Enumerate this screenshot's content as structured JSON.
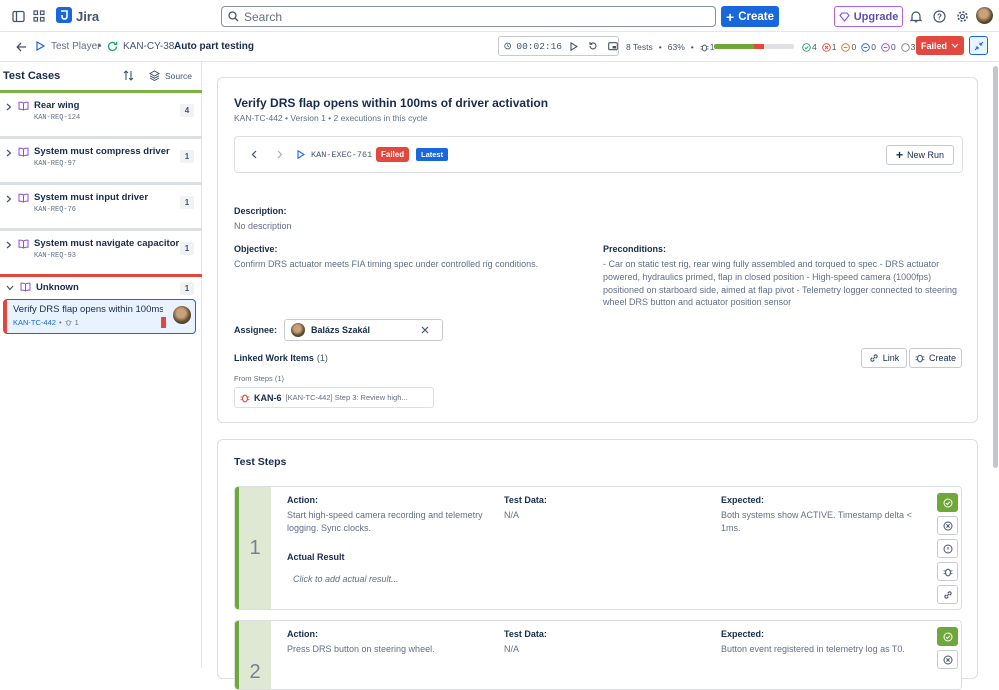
{
  "topbar": {
    "app_name": "Jira",
    "search_placeholder": "Search",
    "create_label": "Create",
    "upgrade_label": "Upgrade"
  },
  "player": {
    "crumb_root": "Test Player",
    "cycle_key": "KAN-CY-38",
    "cycle_name": "Auto part testing",
    "timer": "00:02:16",
    "tests_count": "8 Tests",
    "percent": "63%",
    "bug_count": "1",
    "progress": {
      "passed": 0.5,
      "failed": 0.125,
      "other": 0
    },
    "counts": {
      "passed": "4",
      "failed": "1",
      "blocked": "0",
      "in_progress": "0",
      "not_executed": "0",
      "other": "3"
    },
    "status": "Failed"
  },
  "left_panel": {
    "title": "Test Cases",
    "source_label": "Source",
    "groups": [
      {
        "name": "Rear wing",
        "key": "KAN-REQ-124",
        "count": "4",
        "color": "#7cb342"
      },
      {
        "name": "System must compress driver",
        "key": "KAN-REQ-97",
        "count": "1",
        "color": "#dcdfe4"
      },
      {
        "name": "System must input driver",
        "key": "KAN-REQ-76",
        "count": "1",
        "color": "#dcdfe4"
      },
      {
        "name": "System must navigate capacitor",
        "key": "KAN-REQ-93",
        "count": "1",
        "color": "#dcdfe4"
      },
      {
        "name": "Unknown",
        "key": "",
        "count": "1",
        "color": "#e2483d"
      }
    ],
    "selected_case": {
      "title": "Verify DRS flap opens within 100ms ...",
      "key": "KAN-TC-442",
      "bugs": "1"
    }
  },
  "test_case": {
    "title": "Verify DRS flap opens within 100ms of driver activation",
    "meta": "KAN-TC-442 • Version 1 • 2 executions in this cycle",
    "execution": {
      "key": "KAN-EXEC-761",
      "status": "Failed",
      "tag": "Latest",
      "new_run_label": "New Run"
    },
    "description_label": "Description:",
    "description": "No description",
    "objective_label": "Objective:",
    "objective": "Confirm DRS actuator meets FIA timing spec under controlled rig conditions.",
    "preconditions_label": "Preconditions:",
    "preconditions": "- Car on static test rig, rear wing fully assembled and torqued to spec - DRS actuator powered, hydraulics primed, flap in closed position - High-speed camera (1000fps) positioned on starboard side, aimed at flap pivot - Telemetry logger connected to steering wheel DRS button and actuator position sensor",
    "assignee_label": "Assignee:",
    "assignee": "Balázs Szakál",
    "linked_label": "Linked Work Items",
    "linked_count": "(1)",
    "link_btn": "Link",
    "create_btn": "Create",
    "from_steps": "From Steps (1)",
    "linked_item": {
      "key": "KAN-6",
      "summary": "[KAN-TC-442] Step 3: Review high..."
    }
  },
  "test_steps": {
    "title": "Test Steps",
    "action_label": "Action:",
    "data_label": "Test Data:",
    "expected_label": "Expected:",
    "actual_label": "Actual Result",
    "actual_placeholder": "Click to add actual result...",
    "steps": [
      {
        "num": "1",
        "action": "Start high-speed camera recording and telemetry logging. Sync clocks.",
        "data": "N/A",
        "expected": "Both systems show ACTIVE. Timestamp delta < 1ms."
      },
      {
        "num": "2",
        "action": "Press DRS button on steering wheel.",
        "data": "N/A",
        "expected": "Button event registered in telemetry log as T0."
      }
    ]
  }
}
